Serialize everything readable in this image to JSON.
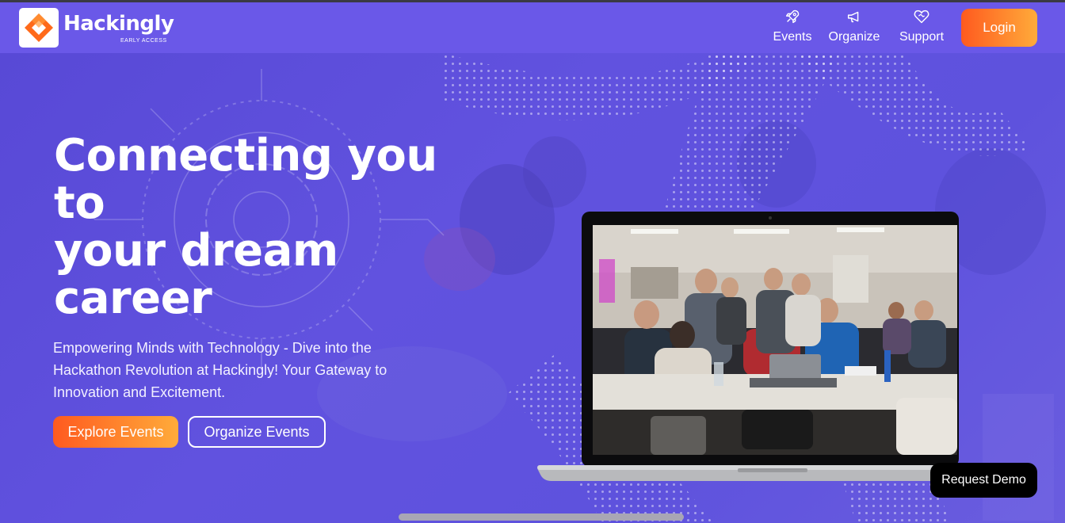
{
  "brand": {
    "name": "Hackingly",
    "tagline": "EARLY ACCESS"
  },
  "nav": {
    "items": [
      {
        "label": "Events",
        "icon": "rocket-icon"
      },
      {
        "label": "Organize",
        "icon": "megaphone-icon"
      },
      {
        "label": "Support",
        "icon": "heart-handshake-icon"
      }
    ],
    "login_label": "Login"
  },
  "hero": {
    "headline_lines": [
      "Connecting you",
      "to",
      "your dream",
      "career"
    ],
    "subtext": "Empowering Minds with Technology - Dive into the Hackathon Revolution at Hackingly! Your Gateway to Innovation and Excitement.",
    "explore_label": "Explore Events",
    "organize_label": "Organize Events"
  },
  "widget": {
    "request_demo_label": "Request Demo"
  },
  "colors": {
    "primary": "#6a58e8",
    "hero_bg": "#5b4fd8",
    "accent_start": "#ff5a1f",
    "accent_end": "#ffab3a"
  }
}
